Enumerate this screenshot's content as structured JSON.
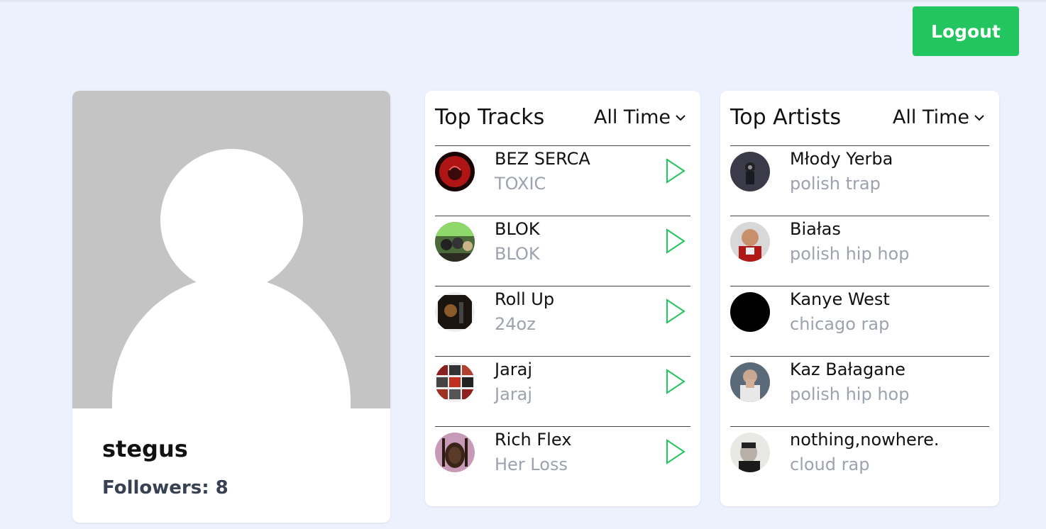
{
  "header": {
    "logout_label": "Logout"
  },
  "profile": {
    "username": "stegus",
    "followers_text": "Followers: 8"
  },
  "top_tracks": {
    "title": "Top Tracks",
    "range_selected": "All Time",
    "items": [
      {
        "name": "BEZ SERCA",
        "album": "TOXIC"
      },
      {
        "name": "BLOK",
        "album": "BLOK"
      },
      {
        "name": "Roll Up",
        "album": "24oz"
      },
      {
        "name": "Jaraj",
        "album": "Jaraj"
      },
      {
        "name": "Rich Flex",
        "album": "Her Loss"
      }
    ]
  },
  "top_artists": {
    "title": "Top Artists",
    "range_selected": "All Time",
    "items": [
      {
        "name": "Młody Yerba",
        "genre": "polish trap"
      },
      {
        "name": "Białas",
        "genre": "polish hip hop"
      },
      {
        "name": "Kanye West",
        "genre": "chicago rap"
      },
      {
        "name": "Kaz Bałagane",
        "genre": "polish hip hop"
      },
      {
        "name": "nothing,nowhere.",
        "genre": "cloud rap"
      }
    ]
  },
  "colors": {
    "background": "#ecf1fd",
    "accent_green": "#22c55e",
    "muted_text": "#9ca3af"
  },
  "icons": {
    "dropdown": "chevron-down-icon",
    "play": "play-icon",
    "avatar_placeholder": "user-silhouette-icon"
  }
}
